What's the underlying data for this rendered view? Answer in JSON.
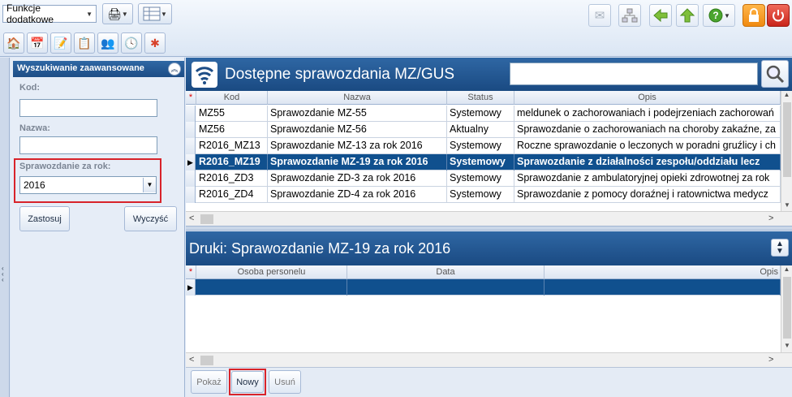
{
  "toolbar": {
    "extras_label": "Funkcje dodatkowe",
    "nav_buttons": [
      "home-icon",
      "calendar-icon",
      "stamp-icon",
      "documents-icon",
      "people-icon",
      "refresh-clock-icon",
      "medical-icon"
    ],
    "right_buttons": [
      "mail-icon",
      "network-icon",
      "arrow-left-icon",
      "arrow-up-icon",
      "help-icon",
      "lock-icon",
      "power-icon"
    ]
  },
  "search_panel": {
    "title": "Wyszukiwanie zaawansowane",
    "code_label": "Kod:",
    "code_value": "",
    "name_label": "Nazwa:",
    "name_value": "",
    "year_label": "Sprawozdanie za rok:",
    "year_value": "2016",
    "apply_label": "Zastosuj",
    "clear_label": "Wyczyść"
  },
  "reports": {
    "title": "Dostępne sprawozdania MZ/GUS",
    "search_value": "",
    "columns": [
      "Kod",
      "Nazwa",
      "Status",
      "Opis"
    ],
    "rows": [
      {
        "kod": "MZ55",
        "nazwa": "Sprawozdanie MZ-55",
        "status": "Systemowy",
        "opis": "meldunek o zachorowaniach i podejrzeniach zachorowań"
      },
      {
        "kod": "MZ56",
        "nazwa": "Sprawozdanie MZ-56",
        "status": "Aktualny",
        "opis": "Sprawozdanie o zachorowaniach na choroby zakaźne, za"
      },
      {
        "kod": "R2016_MZ13",
        "nazwa": "Sprawozdanie MZ-13 za rok 2016",
        "status": "Systemowy",
        "opis": "Roczne sprawozdanie o leczonych w poradni gruźlicy i ch"
      },
      {
        "kod": "R2016_MZ19",
        "nazwa": "Sprawozdanie MZ-19 za rok 2016",
        "status": "Systemowy",
        "opis": "Sprawozdanie z działalności zespołu/oddziału lecz"
      },
      {
        "kod": "R2016_ZD3",
        "nazwa": "Sprawozdanie ZD-3 za rok 2016",
        "status": "Systemowy",
        "opis": "Sprawozdanie z ambulatoryjnej opieki zdrowotnej za rok"
      },
      {
        "kod": "R2016_ZD4",
        "nazwa": "Sprawozdanie ZD-4 za rok 2016",
        "status": "Systemowy",
        "opis": "Sprawozdanie z pomocy doraźnej i ratownictwa medycz"
      }
    ]
  },
  "prints": {
    "title": "Druki: Sprawozdanie MZ-19 za rok 2016",
    "columns": [
      "Osoba personelu",
      "Data",
      "Opis"
    ],
    "show_label": "Pokaż",
    "new_label": "Nowy",
    "delete_label": "Usuń"
  }
}
